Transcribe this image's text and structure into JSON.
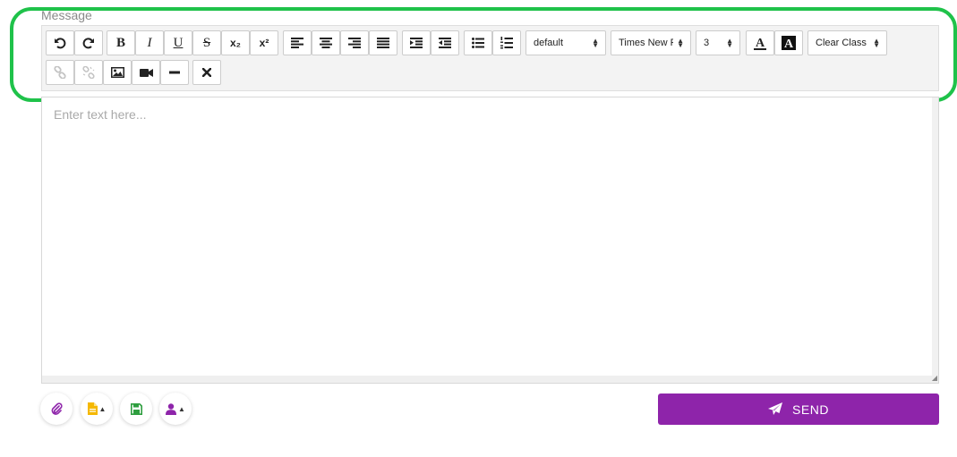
{
  "form": {
    "message_label": "Message",
    "placeholder": "Enter text here...",
    "send_label": "SEND"
  },
  "toolbar": {
    "buttons": {
      "undo": "undo-icon",
      "redo": "redo-icon",
      "bold": "B",
      "italic": "I",
      "underline": "U",
      "strikethrough": "S",
      "subscript": "x₂",
      "superscript": "x²",
      "horizontal_rule": "minus-icon",
      "remove_format": "close-icon"
    },
    "format_block": "default",
    "font_name": "Times New Roman",
    "font_size": "3",
    "class_select": "Clear Class"
  },
  "colors": {
    "highlight_border": "#1fc24a",
    "send_button": "#8e24aa",
    "attach_icon": "#8e24aa",
    "template_icon": "#f5b800",
    "save_icon": "#2e9e3f",
    "user_icon": "#8e24aa"
  },
  "actions": {
    "attach": "paperclip-icon",
    "template": "file-icon",
    "save": "save-icon",
    "contact": "user-icon"
  }
}
